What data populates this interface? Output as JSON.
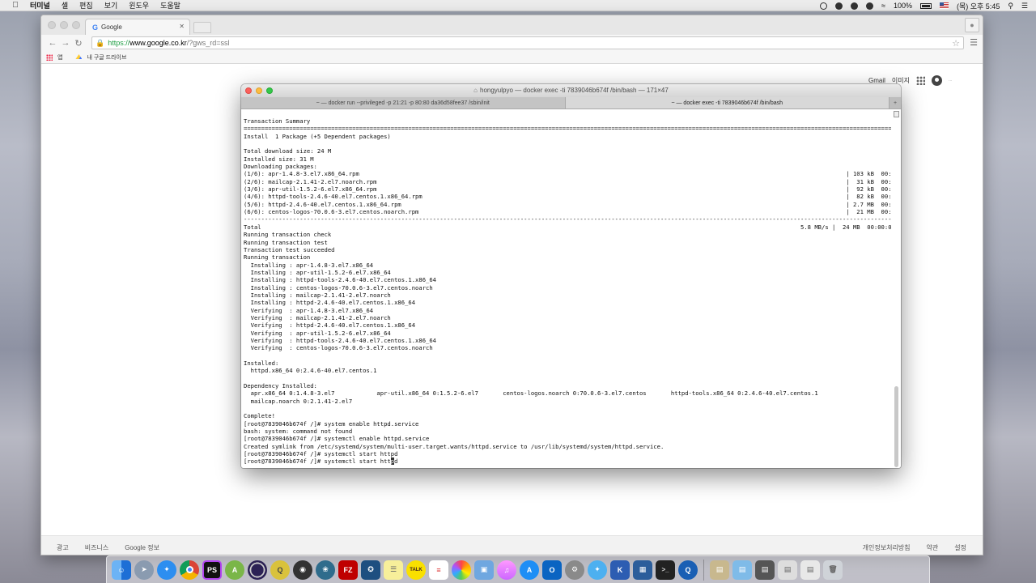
{
  "menubar": {
    "app_name": "터미널",
    "menus": [
      "셸",
      "편집",
      "보기",
      "윈도우",
      "도움말"
    ],
    "battery": "100%",
    "clock": "(목) 오후 5:45"
  },
  "browser": {
    "tab_title": "Google",
    "url_https": "https://",
    "url_host": "www.google.co.kr",
    "url_path": "/?gws_rd=ssl",
    "bookmarks": {
      "apps_label": "앱",
      "drive_label": "내 구글 드라이브"
    },
    "google_top": {
      "gmail": "Gmail",
      "images": "이미지"
    },
    "footer": {
      "left": [
        "광고",
        "비즈니스",
        "Google 정보"
      ],
      "right": [
        "개인정보처리방침",
        "약관",
        "설정"
      ]
    }
  },
  "terminal": {
    "title": "hongyulpyo — docker exec -ti 7839046b674f /bin/bash — 171×47",
    "tabs": [
      "~ — docker run --privileged -p 21:21 -p 80:80 da36d58fee37 /sbin/init",
      "~ — docker exec -ti 7839046b674f /bin/bash"
    ],
    "output": "Transaction Summary\n================================================================================================================================================================================================================\nInstall  1 Package (+5 Dependent packages)\n\nTotal download size: 24 M\nInstalled size: 31 M\nDownloading packages:\n(1/6): apr-1.4.8-3.el7.x86_64.rpm                                                                                                                                           | 103 kB  00:00:00\n(2/6): mailcap-2.1.41-2.el7.noarch.rpm                                                                                                                                      |  31 kB  00:00:00\n(3/6): apr-util-1.5.2-6.el7.x86_64.rpm                                                                                                                                      |  92 kB  00:00:00\n(4/6): httpd-tools-2.4.6-40.el7.centos.1.x86_64.rpm                                                                                                                         |  82 kB  00:00:00\n(5/6): httpd-2.4.6-40.el7.centos.1.x86_64.rpm                                                                                                                               | 2.7 MB  00:00:00\n(6/6): centos-logos-70.0.6-3.el7.centos.noarch.rpm                                                                                                                          |  21 MB  00:00:04\n----------------------------------------------------------------------------------------------------------------------------------------------------------------------------------------------------------------\nTotal                                                                                                                                                          5.8 MB/s |  24 MB  00:00:04\nRunning transaction check\nRunning transaction test\nTransaction test succeeded\nRunning transaction\n  Installing : apr-1.4.8-3.el7.x86_64                                                                                                                                                            1/6\n  Installing : apr-util-1.5.2-6.el7.x86_64                                                                                                                                                       2/6\n  Installing : httpd-tools-2.4.6-40.el7.centos.1.x86_64                                                                                                                                          3/6\n  Installing : centos-logos-70.0.6-3.el7.centos.noarch                                                                                                                                           4/6\n  Installing : mailcap-2.1.41-2.el7.noarch                                                                                                                                                       5/6\n  Installing : httpd-2.4.6-40.el7.centos.1.x86_64                                                                                                                                                6/6\n  Verifying  : apr-1.4.8-3.el7.x86_64                                                                                                                                                            1/6\n  Verifying  : mailcap-2.1.41-2.el7.noarch                                                                                                                                                       2/6\n  Verifying  : httpd-2.4.6-40.el7.centos.1.x86_64                                                                                                                                                3/6\n  Verifying  : apr-util-1.5.2-6.el7.x86_64                                                                                                                                                       4/6\n  Verifying  : httpd-tools-2.4.6-40.el7.centos.1.x86_64                                                                                                                                          5/6\n  Verifying  : centos-logos-70.0.6-3.el7.centos.noarch                                                                                                                                           6/6\n\nInstalled:\n  httpd.x86_64 0:2.4.6-40.el7.centos.1\n\nDependency Installed:\n  apr.x86_64 0:1.4.8-3.el7            apr-util.x86_64 0:1.5.2-6.el7       centos-logos.noarch 0:70.0.6-3.el7.centos       httpd-tools.x86_64 0:2.4.6-40.el7.centos.1\n  mailcap.noarch 0:2.1.41-2.el7\n\nComplete!\n[root@7839046b674f /]# system enable httpd.service\nbash: system: command not found\n[root@7839046b674f /]# systemctl enable httpd.service\nCreated symlink from /etc/systemd/system/multi-user.target.wants/httpd.service to /usr/lib/systemd/system/httpd.service.\n[root@7839046b674f /]# systemctl start httpd",
    "prompt_line_before_cursor": "[root@7839046b674f /]# systemctl start htt",
    "prompt_line_cursor_char": "p",
    "prompt_line_after_cursor": "d"
  },
  "dock": {
    "icons": [
      "finder-icon",
      "launchpad-icon",
      "safari-icon",
      "chrome-icon",
      "phpstorm-icon",
      "android-studio-icon",
      "eclipse-icon",
      "keka-icon",
      "filezilla-icon",
      "mysql-workbench-icon",
      "stickies-icon",
      "kakaotalk-icon",
      "photos-icon",
      "preview-icon",
      "itunes-icon",
      "app-store-icon",
      "outlook-icon",
      "system-preferences-icon",
      "terminal-icon",
      "quicktime-icon",
      "trash-icon"
    ]
  },
  "colors": {
    "https_green": "#1e9f43",
    "terminal_bg": "#ffffff",
    "terminal_text": "#111111"
  }
}
